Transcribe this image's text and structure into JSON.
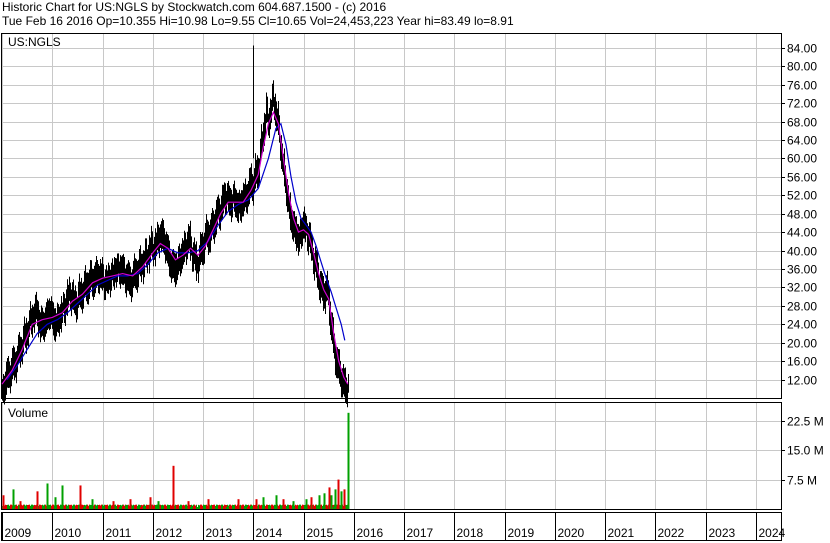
{
  "header": {
    "line1": "Historic Chart for US:NGLS by Stockwatch.com 604.687.1500 - (c) 2016",
    "line2": "Tue Feb 16 2016    Op=10.355   Hi=10.98   Lo=9.55   Cl=10.65   Vol=24,453,223   Year hi=83.49   lo=8.91"
  },
  "chart_data": [
    {
      "type": "line",
      "title": "US:NGLS",
      "x_ticks": [
        "2009",
        "2010",
        "2011",
        "2012",
        "2013",
        "2014",
        "2015",
        "2016",
        "2017",
        "2018",
        "2019",
        "2020",
        "2021",
        "2022",
        "2023",
        "2024"
      ],
      "y_ticks": [
        "84.00",
        "80.00",
        "76.00",
        "72.00",
        "68.00",
        "64.00",
        "60.00",
        "56.00",
        "52.00",
        "48.00",
        "44.00",
        "40.00",
        "36.00",
        "32.00",
        "28.00",
        "24.00",
        "20.00",
        "16.00",
        "12.00"
      ],
      "ylim": [
        8,
        87
      ],
      "xlim": [
        2009,
        2024.5
      ],
      "grid": true,
      "price_color": "#000000",
      "ma_short_color": "#d000d0",
      "ma_long_color": "#0000cc",
      "price": [
        [
          2009.0,
          9.5
        ],
        [
          2009.1,
          12.5
        ],
        [
          2009.2,
          14.5
        ],
        [
          2009.3,
          16.5
        ],
        [
          2009.4,
          20.0
        ],
        [
          2009.5,
          22.5
        ],
        [
          2009.6,
          25.5
        ],
        [
          2009.7,
          27.0
        ],
        [
          2009.75,
          23.5
        ],
        [
          2009.85,
          24.5
        ],
        [
          2009.95,
          27.0
        ],
        [
          2010.05,
          24.0
        ],
        [
          2010.15,
          25.5
        ],
        [
          2010.25,
          28.0
        ],
        [
          2010.35,
          31.0
        ],
        [
          2010.45,
          28.5
        ],
        [
          2010.55,
          30.5
        ],
        [
          2010.65,
          32.0
        ],
        [
          2010.75,
          33.5
        ],
        [
          2010.85,
          34.0
        ],
        [
          2010.95,
          35.0
        ],
        [
          2011.05,
          33.0
        ],
        [
          2011.15,
          34.0
        ],
        [
          2011.25,
          35.5
        ],
        [
          2011.35,
          36.0
        ],
        [
          2011.45,
          34.5
        ],
        [
          2011.55,
          33.0
        ],
        [
          2011.65,
          35.0
        ],
        [
          2011.75,
          36.5
        ],
        [
          2011.85,
          38.0
        ],
        [
          2011.95,
          40.5
        ],
        [
          2012.05,
          41.0
        ],
        [
          2012.15,
          43.5
        ],
        [
          2012.25,
          41.5
        ],
        [
          2012.35,
          37.0
        ],
        [
          2012.45,
          36.0
        ],
        [
          2012.55,
          38.5
        ],
        [
          2012.65,
          41.0
        ],
        [
          2012.72,
          42.5
        ],
        [
          2012.8,
          39.0
        ],
        [
          2012.88,
          37.0
        ],
        [
          2012.95,
          39.5
        ],
        [
          2013.05,
          43.0
        ],
        [
          2013.15,
          44.0
        ],
        [
          2013.25,
          47.0
        ],
        [
          2013.35,
          49.0
        ],
        [
          2013.45,
          52.0
        ],
        [
          2013.55,
          50.0
        ],
        [
          2013.62,
          51.5
        ],
        [
          2013.7,
          49.0
        ],
        [
          2013.8,
          51.0
        ],
        [
          2013.9,
          52.5
        ],
        [
          2013.95,
          55.0
        ],
        [
          2014.0,
          54.0
        ],
        [
          2014.05,
          57.0
        ],
        [
          2014.1,
          58.0
        ],
        [
          2014.15,
          62.0
        ],
        [
          2014.2,
          66.0
        ],
        [
          2014.25,
          70.0
        ],
        [
          2014.3,
          68.0
        ],
        [
          2014.35,
          71.0
        ],
        [
          2014.4,
          73.0
        ],
        [
          2014.45,
          70.0
        ],
        [
          2014.5,
          67.0
        ],
        [
          2014.55,
          62.0
        ],
        [
          2014.6,
          58.0
        ],
        [
          2014.65,
          54.0
        ],
        [
          2014.7,
          50.0
        ],
        [
          2014.75,
          47.0
        ],
        [
          2014.8,
          45.0
        ],
        [
          2014.85,
          44.0
        ],
        [
          2014.9,
          42.0
        ],
        [
          2014.95,
          44.0
        ],
        [
          2015.0,
          46.0
        ],
        [
          2015.05,
          44.0
        ],
        [
          2015.1,
          43.0
        ],
        [
          2015.15,
          41.0
        ],
        [
          2015.2,
          38.0
        ],
        [
          2015.25,
          36.0
        ],
        [
          2015.3,
          34.0
        ],
        [
          2015.35,
          31.0
        ],
        [
          2015.4,
          30.5
        ],
        [
          2015.45,
          32.0
        ],
        [
          2015.5,
          29.0
        ],
        [
          2015.55,
          24.0
        ],
        [
          2015.6,
          19.0
        ],
        [
          2015.65,
          16.5
        ],
        [
          2015.7,
          14.0
        ],
        [
          2015.75,
          12.5
        ],
        [
          2015.8,
          11.0
        ],
        [
          2015.85,
          9.8
        ],
        [
          2015.88,
          10.6
        ]
      ],
      "ma_short": [
        [
          2009.0,
          11.0
        ],
        [
          2009.2,
          14.0
        ],
        [
          2009.4,
          18.5
        ],
        [
          2009.6,
          24.0
        ],
        [
          2009.8,
          25.0
        ],
        [
          2010.0,
          25.5
        ],
        [
          2010.2,
          26.5
        ],
        [
          2010.4,
          29.0
        ],
        [
          2010.6,
          30.5
        ],
        [
          2010.8,
          33.0
        ],
        [
          2011.0,
          34.0
        ],
        [
          2011.2,
          34.5
        ],
        [
          2011.4,
          35.0
        ],
        [
          2011.6,
          34.5
        ],
        [
          2011.8,
          36.5
        ],
        [
          2012.0,
          39.5
        ],
        [
          2012.15,
          41.5
        ],
        [
          2012.3,
          40.5
        ],
        [
          2012.45,
          38.0
        ],
        [
          2012.6,
          39.0
        ],
        [
          2012.75,
          40.5
        ],
        [
          2012.9,
          39.0
        ],
        [
          2013.05,
          41.0
        ],
        [
          2013.2,
          44.5
        ],
        [
          2013.35,
          48.0
        ],
        [
          2013.5,
          50.5
        ],
        [
          2013.65,
          50.5
        ],
        [
          2013.8,
          50.5
        ],
        [
          2013.95,
          53.0
        ],
        [
          2014.1,
          56.5
        ],
        [
          2014.2,
          62.5
        ],
        [
          2014.3,
          67.5
        ],
        [
          2014.4,
          70.0
        ],
        [
          2014.5,
          67.5
        ],
        [
          2014.6,
          60.0
        ],
        [
          2014.7,
          52.5
        ],
        [
          2014.8,
          47.0
        ],
        [
          2014.9,
          44.0
        ],
        [
          2015.0,
          44.5
        ],
        [
          2015.1,
          43.5
        ],
        [
          2015.2,
          39.5
        ],
        [
          2015.3,
          35.0
        ],
        [
          2015.4,
          31.5
        ],
        [
          2015.5,
          29.5
        ],
        [
          2015.6,
          22.0
        ],
        [
          2015.7,
          16.0
        ],
        [
          2015.8,
          12.5
        ],
        [
          2015.88,
          11.0
        ]
      ],
      "ma_long": [
        [
          2009.1,
          12.0
        ],
        [
          2009.3,
          15.0
        ],
        [
          2009.5,
          18.5
        ],
        [
          2009.7,
          22.0
        ],
        [
          2009.9,
          24.0
        ],
        [
          2010.1,
          25.0
        ],
        [
          2010.3,
          26.5
        ],
        [
          2010.5,
          28.5
        ],
        [
          2010.7,
          30.5
        ],
        [
          2010.9,
          32.5
        ],
        [
          2011.1,
          33.5
        ],
        [
          2011.3,
          34.5
        ],
        [
          2011.5,
          34.5
        ],
        [
          2011.7,
          35.0
        ],
        [
          2011.9,
          37.0
        ],
        [
          2012.1,
          39.5
        ],
        [
          2012.3,
          40.5
        ],
        [
          2012.5,
          39.5
        ],
        [
          2012.7,
          39.5
        ],
        [
          2012.9,
          40.0
        ],
        [
          2013.1,
          42.0
        ],
        [
          2013.3,
          45.5
        ],
        [
          2013.5,
          48.5
        ],
        [
          2013.7,
          50.0
        ],
        [
          2013.9,
          51.0
        ],
        [
          2014.1,
          53.5
        ],
        [
          2014.3,
          60.0
        ],
        [
          2014.45,
          66.5
        ],
        [
          2014.55,
          67.5
        ],
        [
          2014.65,
          63.0
        ],
        [
          2014.75,
          56.0
        ],
        [
          2014.85,
          50.5
        ],
        [
          2014.95,
          47.0
        ],
        [
          2015.05,
          45.5
        ],
        [
          2015.15,
          44.0
        ],
        [
          2015.25,
          41.0
        ],
        [
          2015.35,
          37.5
        ],
        [
          2015.45,
          34.0
        ],
        [
          2015.55,
          31.0
        ],
        [
          2015.65,
          27.5
        ],
        [
          2015.75,
          24.0
        ],
        [
          2015.82,
          20.5
        ]
      ]
    },
    {
      "type": "bar",
      "title": "Volume",
      "y_ticks": [
        "22.5 M",
        "15.0 M",
        "7.5 M"
      ],
      "ylim": [
        0,
        27
      ],
      "up_color": "#00a000",
      "down_color": "#e00000",
      "neutral_color": "#9a9a9a",
      "baseline_m": 0.8,
      "spikes": [
        {
          "x": 2009.02,
          "value": 3.5,
          "dir": "down"
        },
        {
          "x": 2009.22,
          "value": 5.0,
          "dir": "up"
        },
        {
          "x": 2009.35,
          "value": 2.0,
          "dir": "down"
        },
        {
          "x": 2009.7,
          "value": 4.5,
          "dir": "down"
        },
        {
          "x": 2009.9,
          "value": 6.5,
          "dir": "up"
        },
        {
          "x": 2010.05,
          "value": 3.0,
          "dir": "up"
        },
        {
          "x": 2010.2,
          "value": 6.0,
          "dir": "up"
        },
        {
          "x": 2010.55,
          "value": 6.0,
          "dir": "down"
        },
        {
          "x": 2010.8,
          "value": 2.5,
          "dir": "up"
        },
        {
          "x": 2011.2,
          "value": 2.0,
          "dir": "down"
        },
        {
          "x": 2011.55,
          "value": 2.5,
          "dir": "down"
        },
        {
          "x": 2011.95,
          "value": 3.0,
          "dir": "down"
        },
        {
          "x": 2012.1,
          "value": 2.0,
          "dir": "up"
        },
        {
          "x": 2012.4,
          "value": 11.0,
          "dir": "down"
        },
        {
          "x": 2012.7,
          "value": 2.0,
          "dir": "down"
        },
        {
          "x": 2013.1,
          "value": 2.5,
          "dir": "down"
        },
        {
          "x": 2013.7,
          "value": 2.5,
          "dir": "down"
        },
        {
          "x": 2014.05,
          "value": 2.5,
          "dir": "down"
        },
        {
          "x": 2014.2,
          "value": 3.0,
          "dir": "up"
        },
        {
          "x": 2014.45,
          "value": 3.5,
          "dir": "up"
        },
        {
          "x": 2014.6,
          "value": 2.5,
          "dir": "down"
        },
        {
          "x": 2014.8,
          "value": 2.0,
          "dir": "up"
        },
        {
          "x": 2015.05,
          "value": 2.5,
          "dir": "up"
        },
        {
          "x": 2015.15,
          "value": 3.0,
          "dir": "down"
        },
        {
          "x": 2015.3,
          "value": 3.5,
          "dir": "up"
        },
        {
          "x": 2015.4,
          "value": 4.0,
          "dir": "up"
        },
        {
          "x": 2015.5,
          "value": 5.5,
          "dir": "down"
        },
        {
          "x": 2015.55,
          "value": 3.5,
          "dir": "up"
        },
        {
          "x": 2015.62,
          "value": 5.0,
          "dir": "up"
        },
        {
          "x": 2015.68,
          "value": 7.5,
          "dir": "down"
        },
        {
          "x": 2015.74,
          "value": 4.5,
          "dir": "up"
        },
        {
          "x": 2015.8,
          "value": 5.0,
          "dir": "down"
        },
        {
          "x": 2015.88,
          "value": 24.5,
          "dir": "up"
        }
      ]
    }
  ]
}
